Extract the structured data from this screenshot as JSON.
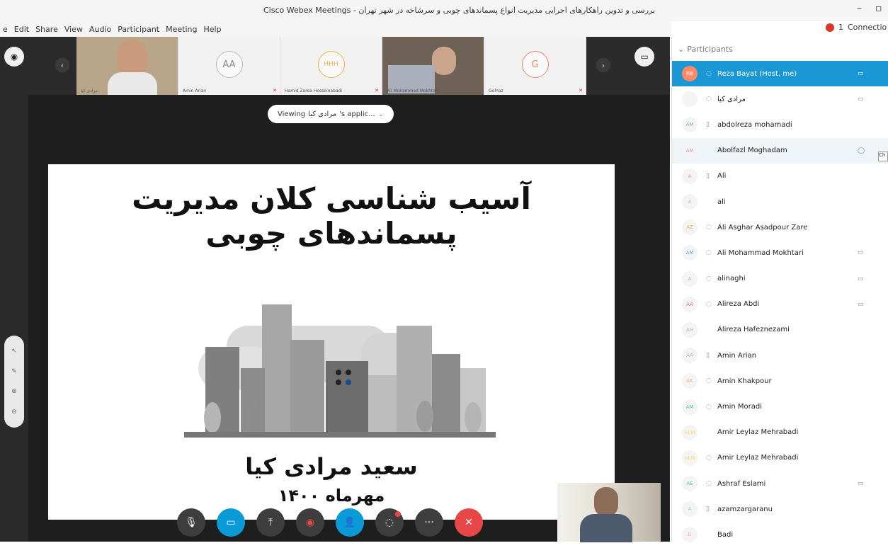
{
  "window": {
    "title_latin": "Cisco Webex Meetings -",
    "title_fa": "بررسی و تدوین راهکارهای اجرایی مدیریت انواع پسماندهای چوبی و سرشاخه در شهر تهران",
    "minimize": "–",
    "maximize": "▫"
  },
  "menu": [
    "e",
    "Edit",
    "Share",
    "View",
    "Audio",
    "Participant",
    "Meeting",
    "Help"
  ],
  "status": {
    "count": "1",
    "label": "Connectio"
  },
  "thumbnails": [
    {
      "name": "مرادی کیا",
      "initials": "",
      "video": true
    },
    {
      "name": "Amin Arian",
      "initials": "AA",
      "video": false
    },
    {
      "name": "Hamid Zarea Hosseinabadi",
      "initials": "HHH",
      "video": false
    },
    {
      "name": "Ali Mohammad Mokhtari",
      "initials": "",
      "video": true
    },
    {
      "name": "Golnaz",
      "initials": "G",
      "video": false
    }
  ],
  "viewing": {
    "prefix": "Viewing",
    "owner": "مرادی کیا",
    "suffix": "'s applic..."
  },
  "slide": {
    "title": "آسیب شناسی کلان مدیریت پسماندهای چوبی",
    "presenter": "سعید مرادی کیا",
    "date": "مهرماه ۱۴۰۰"
  },
  "panel": {
    "header": "Participants",
    "participants": [
      {
        "initials": "RB",
        "name": "Reza Bayat (Host, me)",
        "mic": "◌",
        "cam": "▭",
        "selected": true,
        "color": "#ff8a65"
      },
      {
        "initials": "",
        "name": "مرادی کیا",
        "mic": "◌",
        "cam": "▭",
        "selected": false,
        "color": "#9fb5c8"
      },
      {
        "initials": "AM",
        "name": "abdolreza mohamadi",
        "mic": "▯",
        "cam": "",
        "selected": false,
        "color": "#7fb3d5"
      },
      {
        "initials": "AM",
        "name": "Abolfazl Moghadam",
        "mic": "",
        "cam": "◯",
        "selected": false,
        "color": "#c39bd3"
      },
      {
        "initials": "A",
        "name": "Ali",
        "mic": "▯",
        "cam": "",
        "selected": false,
        "color": "#f1948a"
      },
      {
        "initials": "A",
        "name": "ali",
        "mic": "",
        "cam": "",
        "selected": false,
        "color": "#aab7b8"
      },
      {
        "initials": "AZ",
        "name": "Ali Asghar Asadpour Zare",
        "mic": "◌",
        "cam": "",
        "selected": false,
        "color": "#f5b041"
      },
      {
        "initials": "AM",
        "name": "Ali Mohammad Mokhtari",
        "mic": "◌",
        "cam": "▭",
        "selected": false,
        "color": "#5dade2"
      },
      {
        "initials": "A",
        "name": "alinaghi",
        "mic": "◌",
        "cam": "▭",
        "selected": false,
        "color": "#aab7b8"
      },
      {
        "initials": "AA",
        "name": "Alireza Abdi",
        "mic": "◌",
        "cam": "▭",
        "selected": false,
        "color": "#ec7063"
      },
      {
        "initials": "AH",
        "name": "Alireza Hafeznezami",
        "mic": "",
        "cam": "",
        "selected": false,
        "color": "#aab7b8"
      },
      {
        "initials": "AA",
        "name": "Amin Arian",
        "mic": "▯",
        "cam": "",
        "selected": false,
        "color": "#aab7b8"
      },
      {
        "initials": "AK",
        "name": "Amin Khakpour",
        "mic": "◌",
        "cam": "",
        "selected": false,
        "color": "#f0b27a"
      },
      {
        "initials": "AM",
        "name": "Amin Moradi",
        "mic": "◌",
        "cam": "",
        "selected": false,
        "color": "#48c9b0"
      },
      {
        "initials": "ALM",
        "name": "Amir Leylaz Mehrabadi",
        "mic": "",
        "cam": "",
        "selected": false,
        "color": "#f7dc6f"
      },
      {
        "initials": "ALM",
        "name": "Amir Leylaz Mehrabadi",
        "mic": "◌",
        "cam": "",
        "selected": false,
        "color": "#f7dc6f"
      },
      {
        "initials": "AE",
        "name": "Ashraf Eslami",
        "mic": "◌",
        "cam": "▭",
        "selected": false,
        "color": "#58d68d"
      },
      {
        "initials": "A",
        "name": "azamzargaranu",
        "mic": "▯",
        "cam": "",
        "selected": false,
        "color": "#82e0aa"
      },
      {
        "initials": "B",
        "name": "Badi",
        "mic": "",
        "cam": "",
        "selected": false,
        "color": "#f5b7b1"
      }
    ]
  },
  "tooltip": "Ch"
}
